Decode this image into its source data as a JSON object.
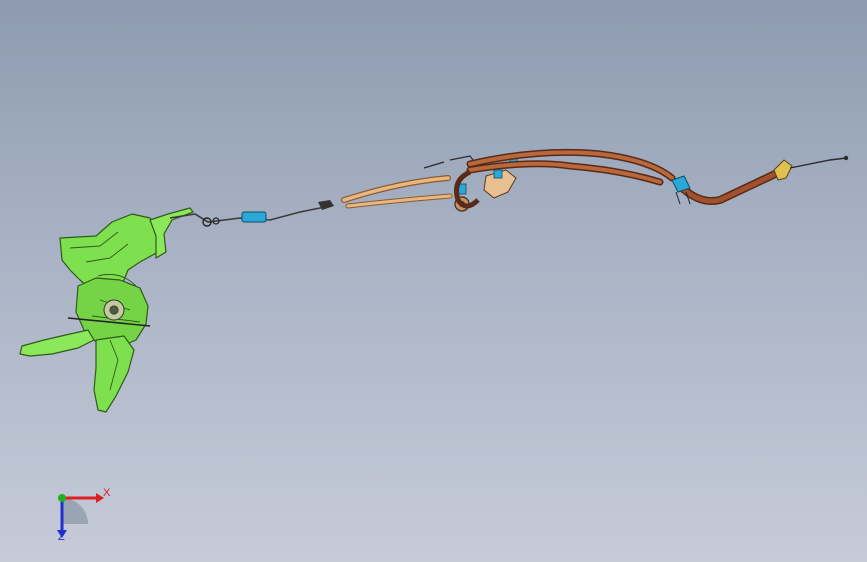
{
  "viewport": {
    "background_top": "#8d9bb0",
    "background_bottom": "#c6cbd8"
  },
  "model": {
    "part_colors": {
      "lever_assembly": "#7fe04f",
      "lever_edge": "#2f5a1a",
      "cable_sheath": "#a0522d",
      "cable_sheath_light": "#e8b880",
      "connector": "#2aa8d8",
      "cable_core": "#3a3a3a"
    },
    "icons": [
      "parking-brake-lever",
      "brake-cable",
      "cable-connector",
      "equalizer-bracket",
      "cable-end-fitting"
    ]
  },
  "triad": {
    "x_label": "X",
    "z_label": "Z",
    "x_color": "#e02020",
    "y_color": "#20b020",
    "z_color": "#2030d0"
  }
}
